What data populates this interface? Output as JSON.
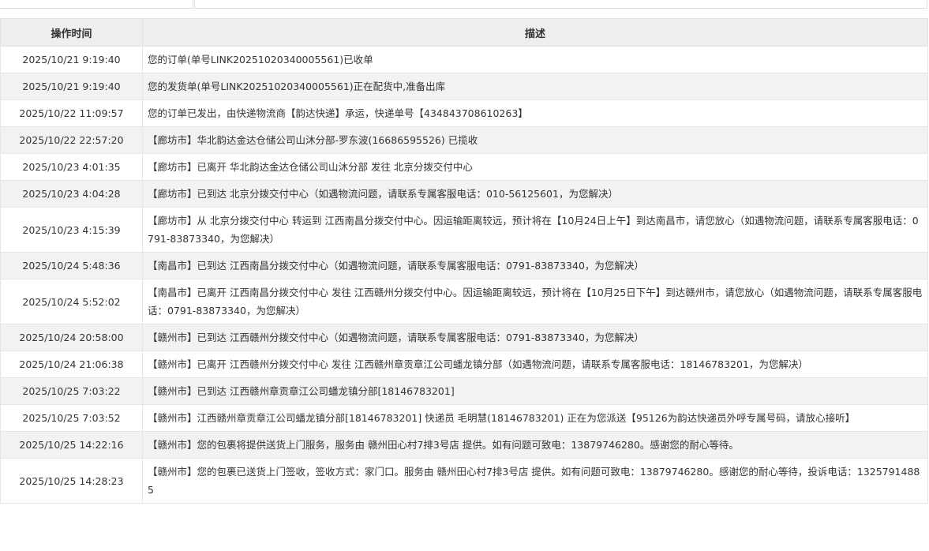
{
  "table": {
    "headers": {
      "time": "操作时间",
      "desc": "描述"
    },
    "rows": [
      {
        "time": "2025/10/21 9:19:40",
        "desc": "您的订单(单号LINK20251020340005561)已收单"
      },
      {
        "time": "2025/10/21 9:19:40",
        "desc": "您的发货单(单号LINK20251020340005561)正在配货中,准备出库"
      },
      {
        "time": "2025/10/22 11:09:57",
        "desc": "您的订单已发出，由快递物流商【韵达快递】承运，快递单号【434843708610263】"
      },
      {
        "time": "2025/10/22 22:57:20",
        "desc": "【廊坊市】华北韵达金达仓储公司山沐分部-罗东波(16686595526) 已揽收"
      },
      {
        "time": "2025/10/23 4:01:35",
        "desc": "【廊坊市】已离开 华北韵达金达仓储公司山沐分部 发往 北京分拨交付中心"
      },
      {
        "time": "2025/10/23 4:04:28",
        "desc": "【廊坊市】已到达 北京分拨交付中心（如遇物流问题，请联系专属客服电话：010-56125601，为您解决）"
      },
      {
        "time": "2025/10/23 4:15:39",
        "desc": "【廊坊市】从 北京分拨交付中心 转运到 江西南昌分拨交付中心。因运输距离较远，预计将在【10月24日上午】到达南昌市，请您放心（如遇物流问题，请联系专属客服电话：0791-83873340，为您解决）"
      },
      {
        "time": "2025/10/24 5:48:36",
        "desc": "【南昌市】已到达 江西南昌分拨交付中心（如遇物流问题，请联系专属客服电话：0791-83873340，为您解决）"
      },
      {
        "time": "2025/10/24 5:52:02",
        "desc": "【南昌市】已离开 江西南昌分拨交付中心 发往 江西赣州分拨交付中心。因运输距离较远，预计将在【10月25日下午】到达赣州市，请您放心（如遇物流问题，请联系专属客服电话：0791-83873340，为您解决）"
      },
      {
        "time": "2025/10/24 20:58:00",
        "desc": "【赣州市】已到达 江西赣州分拨交付中心（如遇物流问题，请联系专属客服电话：0791-83873340，为您解决）"
      },
      {
        "time": "2025/10/24 21:06:38",
        "desc": "【赣州市】已离开 江西赣州分拨交付中心 发往 江西赣州章贡章江公司蟠龙镇分部（如遇物流问题，请联系专属客服电话：18146783201，为您解决）"
      },
      {
        "time": "2025/10/25 7:03:22",
        "desc": "【赣州市】已到达 江西赣州章贡章江公司蟠龙镇分部[18146783201]"
      },
      {
        "time": "2025/10/25 7:03:52",
        "desc": "【赣州市】江西赣州章贡章江公司蟠龙镇分部[18146783201] 快递员 毛明慧(18146783201) 正在为您派送【95126为韵达快递员外呼专属号码，请放心接听】"
      },
      {
        "time": "2025/10/25 14:22:16",
        "desc": "【赣州市】您的包裹将提供送货上门服务，服务由 赣州田心村7排3号店 提供。如有问题可致电：13879746280。感谢您的耐心等待。"
      },
      {
        "time": "2025/10/25 14:28:23",
        "desc": "【赣州市】您的包裹已送货上门签收，签收方式：家门口。服务由 赣州田心村7排3号店 提供。如有问题可致电：13879746280。感谢您的耐心等待，投诉电话：13257914885"
      }
    ]
  }
}
